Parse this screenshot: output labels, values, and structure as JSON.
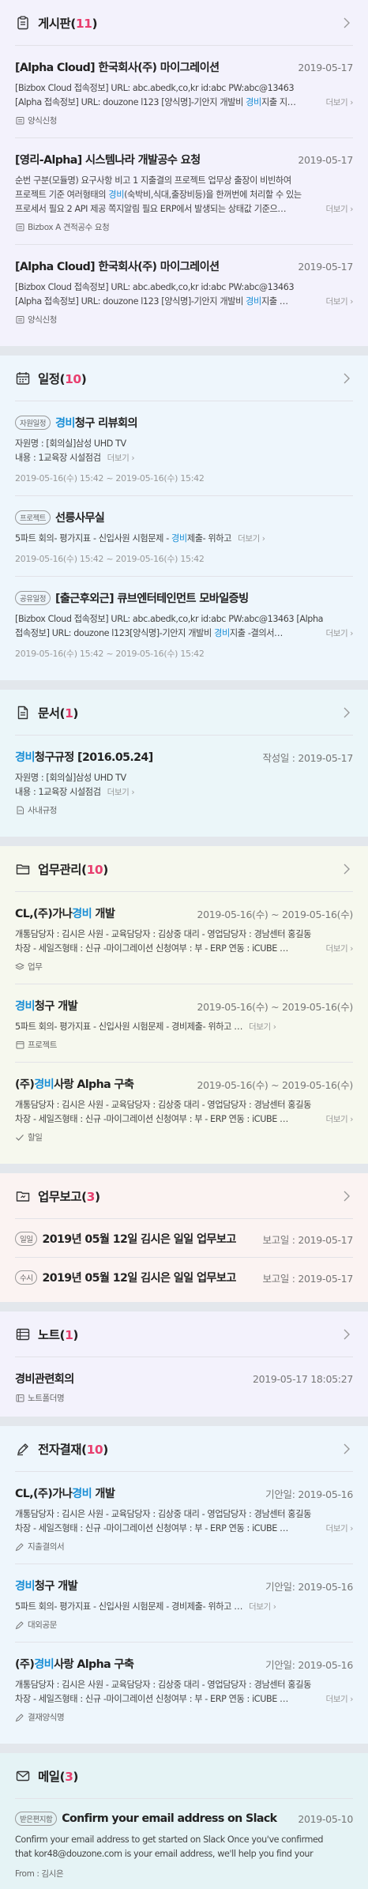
{
  "board": {
    "title": "게시판",
    "count": "11",
    "items": [
      {
        "title": "[Alpha Cloud] 한국회사(주) 마이그레이션",
        "date": "2019-05-17",
        "line1": "[Bizbox Cloud 접속정보] URL: abc.abedk,co,kr id:abc PW:abc@13463",
        "line2_pre": "[Alpha 접속정보] URL: douzone l123 [양식명]-기안지 개발비 ",
        "line2_hl": "경비",
        "line2_post": "지출 지…",
        "more": "더보기",
        "foot": "양식신청"
      },
      {
        "title": "[영리-Alpha] 시스템나라 개발공수 요청",
        "date": "2019-05-17",
        "line1": "순번 구분(모듈명) 요구사항 비고 1 지출결의 프로젝트 업무상 출장이 비빈하여",
        "line2_pre": "프로젝트 기준 여러형태의 ",
        "line2_hl": "경비",
        "line2_post": "(숙박비,식대,출장비등)을 한꺼번에 처리할 수 있는",
        "line3": "프로세서 필요 2 API 제공 쪽지알림 필요 ERP에서 발생되는 상태값 기준으…",
        "more": "더보기",
        "foot": "Bizbox A 견적공수 요청"
      },
      {
        "title": "[Alpha Cloud] 한국회사(주) 마이그레이션",
        "date": "2019-05-17",
        "line1": "[Bizbox Cloud 접속정보] URL: abc.abedk,co,kr id:abc PW:abc@13463",
        "line2_pre": "[Alpha 접속정보] URL: douzone l123 [양식명]-기안지 개발비 ",
        "line2_hl": "경비",
        "line2_post": "지출 …",
        "more": "더보기",
        "foot": "양식신청"
      }
    ]
  },
  "schedule": {
    "title": "일정",
    "count": "10",
    "items": [
      {
        "tag": "자원일정",
        "title_hl": "경비",
        "title_post": "청구 리뷰회의",
        "line1": "자원명 : [회의실]삼성 UHD TV",
        "line2": "내용 : 1교육장 시설점검",
        "more": "더보기",
        "date": "2019-05-16(수) 15:42 ~ 2019-05-16(수) 15:42"
      },
      {
        "tag": "프로젝트",
        "title_hl": "",
        "title_post": "선릉사무실",
        "line1_pre": "5파트 회의- 평가지표 - 신입사원 시험문제 - ",
        "line1_hl": "경비",
        "line1_post": "제출- 위하고",
        "more": "더보기",
        "date": "2019-05-16(수) 15:42 ~ 2019-05-16(수) 15:42"
      },
      {
        "tag": "공유일정",
        "title_hl": "",
        "title_post": "[출근후외근] 큐브엔터테인먼트 모바일증빙",
        "line1": "[Bizbox Cloud 접속정보] URL: abc.abedk,co,kr id:abc PW:abc@13463 [Alpha",
        "line2_pre": "접속정보] URL: douzone l123[양식명]-기안지 개발비 ",
        "line2_hl": "경비",
        "line2_post": "지출 -결의서…",
        "more": "더보기",
        "date": "2019-05-16(수) 15:42 ~ 2019-05-16(수) 15:42"
      }
    ]
  },
  "docs": {
    "title": "문서",
    "count": "1",
    "items": [
      {
        "title_hl": "경비",
        "title_post": "청구규정 [2016.05.24]",
        "date": "작성일 : 2019-05-17",
        "line1": "자원명 : [회의실]삼성 UHD TV",
        "line2": "내용 : 1교육장 시설점검",
        "more": "더보기",
        "foot": "사내규정"
      }
    ]
  },
  "work": {
    "title": "업무관리",
    "count": "10",
    "items": [
      {
        "title_pre": "CL,(주)가나",
        "title_hl": "경비",
        "title_post": " 개발",
        "date": "2019-05-16(수) ~ 2019-05-16(수)",
        "line1": "개통담당자 : 김시은 사원 - 교육담당자 : 김상중 대리 - 영업담당자 : 경남센터 홍길동",
        "line2": "차장 - 세일즈형태 : 신규 -마이그레이션 신청여부 : 부 - ERP 연동 : iCUBE …",
        "more": "더보기",
        "foot": "업무"
      },
      {
        "title_pre": "",
        "title_hl": "경비",
        "title_post": "청구 개발",
        "date": "2019-05-16(수) ~ 2019-05-16(수)",
        "line1": "5파트 회의- 평가지표 - 신입사원 시험문제 - 경비제출- 위하고 …",
        "more": "더보기",
        "foot": "프로젝트"
      },
      {
        "title_pre": "(주)",
        "title_hl": "경비",
        "title_post": "사랑 Alpha 구축",
        "date": "2019-05-16(수) ~ 2019-05-16(수)",
        "line1": "개통담당자 : 김시은 사원 - 교육담당자 : 김상중 대리 - 영업담당자 : 경남센터 홍길동",
        "line2": "차장 - 세일즈형태 : 신규 -마이그레이션 신청여부 : 부 - ERP 연동 : iCUBE …",
        "more": "더보기",
        "foot": "할일"
      }
    ]
  },
  "report": {
    "title": "업무보고",
    "count": "3",
    "items": [
      {
        "tag": "일일",
        "title": "2019년 05월 12일 김시은 일일 업무보고",
        "date": "보고일 : 2019-05-17"
      },
      {
        "tag": "수시",
        "title": "2019년 05월 12일 김시은 일일 업무보고",
        "date": "보고일 : 2019-05-17"
      }
    ]
  },
  "note": {
    "title": "노트",
    "count": "1",
    "items": [
      {
        "title": "경비관련회의",
        "date": "2019-05-17 18:05:27",
        "foot": "노트폴더명"
      }
    ]
  },
  "approval": {
    "title": "전자결재",
    "count": "10",
    "items": [
      {
        "title_pre": "CL,(주)가나",
        "title_hl": "경비",
        "title_post": " 개발",
        "date": "기안일: 2019-05-16",
        "line1": "개통담당자 : 김시은 사원 - 교육담당자 : 김상중 대리 - 영업담당자 : 경남센터 홍길동",
        "line2": "차장 - 세일즈형태 : 신규 -마이그레이션 신청여부 : 부 - ERP 연동 : iCUBE …",
        "more": "더보기",
        "foot": "지출결의서"
      },
      {
        "title_pre": "",
        "title_hl": "경비",
        "title_post": "청구 개발",
        "date": "기안일: 2019-05-16",
        "line1": "5파트 회의- 평가지표 - 신입사원 시험문제 - 경비제출- 위하고 …",
        "more": "더보기",
        "foot": "대외공문"
      },
      {
        "title_pre": "(주)",
        "title_hl": "경비",
        "title_post": "사랑 Alpha 구축",
        "date": "기안일: 2019-05-16",
        "line1": "개통담당자 : 김시은 사원 - 교육담당자 : 김상중 대리 - 영업담당자 : 경남센터 홍길동",
        "line2": "차장 - 세일즈형태 : 신규 -마이그레이션 신청여부 : 부 - ERP 연동 : iCUBE …",
        "more": "더보기",
        "foot": "결재양식명"
      }
    ]
  },
  "mail": {
    "title": "메일",
    "count": "3",
    "items": [
      {
        "tag": "받은편지함",
        "title": "Confirm your email address on Slack",
        "date": "2019-05-10",
        "line1": "Confirm your email address to get started on Slack Once you've confirmed",
        "line2": "that kor48@douzone.com is your email address, we'll help you find your",
        "from": "From : 김시은"
      }
    ]
  },
  "colors": {
    "accent_count": "#e83f6f",
    "highlight": "#1b8fd6"
  }
}
